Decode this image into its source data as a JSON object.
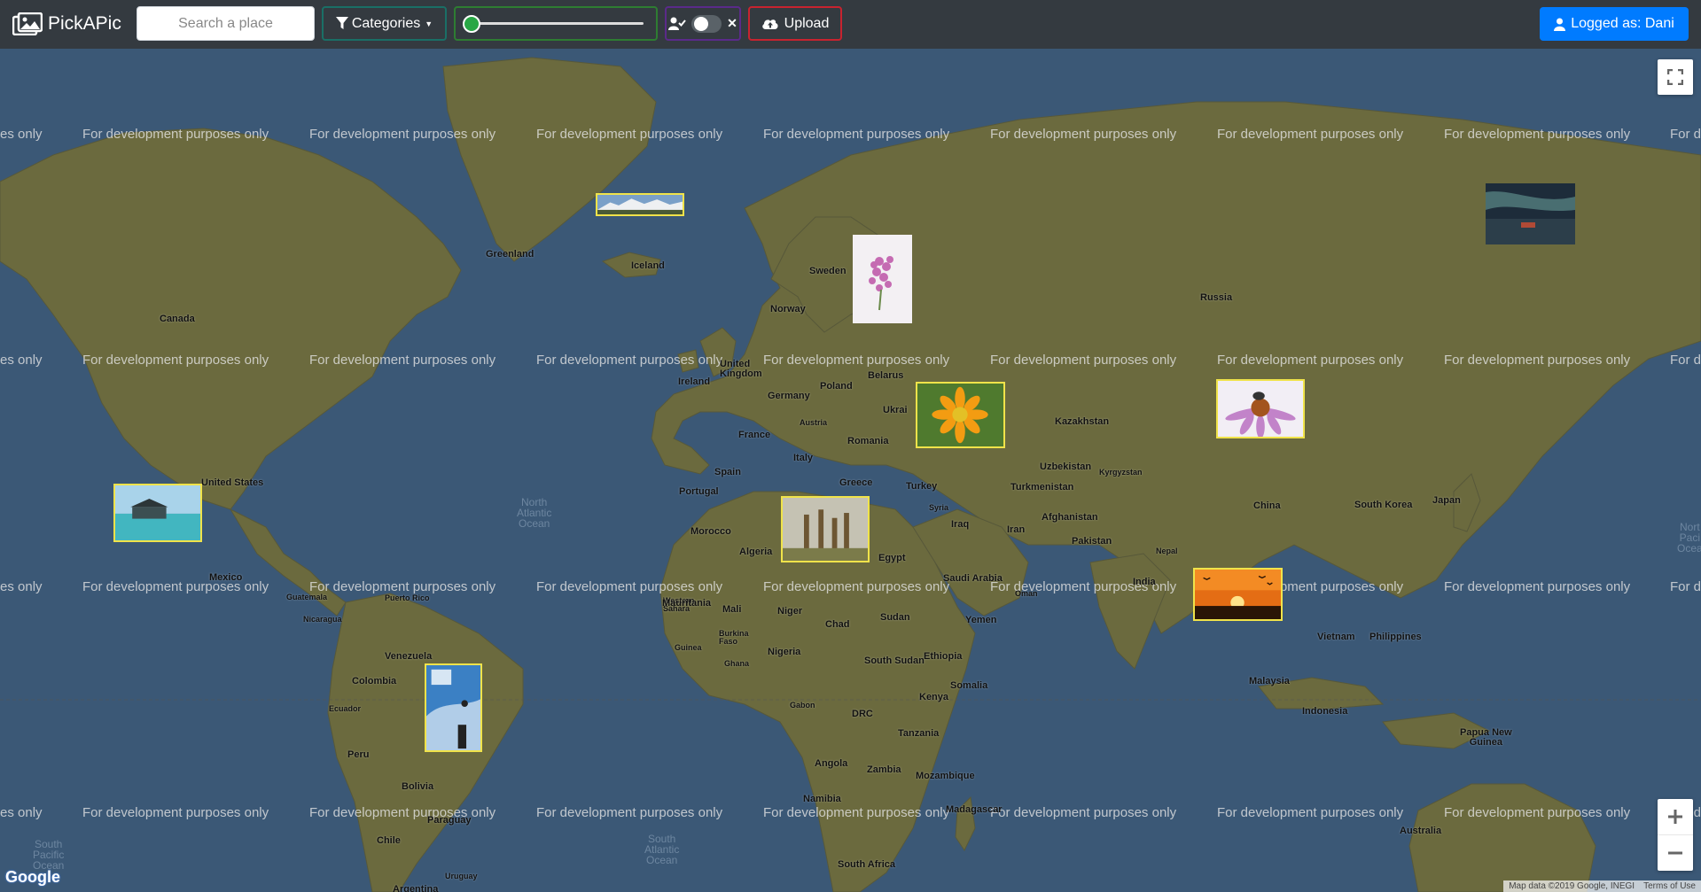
{
  "navbar": {
    "brand": "PickAPic",
    "search_placeholder": "Search a place",
    "categories_label": "Categories",
    "upload_label": "Upload",
    "user_label": "Logged as: Dani",
    "toggle_icon_user": "user-check-icon",
    "toggle_icon_close": "close-icon"
  },
  "map": {
    "watermark": "For development purposes only",
    "watermark_left": "es only",
    "watermark_right": "For d",
    "attribution_data": "Map data ©2019 Google, INEGI",
    "attribution_terms": "Terms of Use",
    "google_logo": "Google",
    "places": {
      "greenland": "Greenland",
      "iceland": "Iceland",
      "canada": "Canada",
      "united_states": "United States",
      "mexico": "Mexico",
      "sweden": "Sweden",
      "norway": "Norway",
      "russia": "Russia",
      "united_kingdom": "United\nKingdom",
      "ireland": "Ireland",
      "belarus": "Belarus",
      "poland": "Poland",
      "germany": "Germany",
      "france": "France",
      "ukraine": "Ukrai",
      "austria": "Austria",
      "romania": "Romania",
      "kazakhstan": "Kazakhstan",
      "spain": "Spain",
      "italy": "Italy",
      "portugal": "Portugal",
      "greece": "Greece",
      "turkey": "Turkey",
      "uzbekistan": "Uzbekistan",
      "turkmenistan": "Turkmenistan",
      "china": "China",
      "south_korea": "South Korea",
      "japan": "Japan",
      "morocco": "Morocco",
      "algeria": "Algeria",
      "egypt": "Egypt",
      "iraq": "Iraq",
      "iran": "Iran",
      "afghanistan": "Afghanistan",
      "pakistan": "Pakistan",
      "saudi_arabia": "Saudi Arabia",
      "india": "India",
      "mauritania": "Mauritania",
      "mali": "Mali",
      "niger": "Niger",
      "chad": "Chad",
      "sudan": "Sudan",
      "yemen": "Yemen",
      "nigeria": "Nigeria",
      "ethiopia": "Ethiopia",
      "south_sudan": "South Sudan",
      "somalia": "Somalia",
      "kenya": "Kenya",
      "drc": "DRC",
      "tanzania": "Tanzania",
      "angola": "Angola",
      "zambia": "Zambia",
      "mozambique": "Mozambique",
      "namibia": "Namibia",
      "madagascar": "Madagascar",
      "south_africa": "South Africa",
      "venezuela": "Venezuela",
      "colombia": "Colombia",
      "peru": "Peru",
      "bolivia": "Bolivia",
      "chile": "Chile",
      "paraguay": "Paraguay",
      "argentina": "Argentina",
      "uruguay": "Uruguay",
      "ecuador": "Ecuador",
      "vietnam": "Vietnam",
      "philippines": "Philippines",
      "malaysia": "Malaysia",
      "indonesia": "Indonesia",
      "papua_new_guinea": "Papua New\nGuinea",
      "australia": "Australia",
      "guatemala": "Guatemala",
      "puerto_rico": "Puerto Rico",
      "nicaragua": "Nicaragua",
      "gabon": "Gabon",
      "western_sahara": "Western\nSahara",
      "burkina_faso": "Burkina\nFaso",
      "guinea": "Guinea",
      "ghana": "Ghana",
      "syria": "Syria",
      "oman": "Oman",
      "kyrgyzstan": "Kyrgyzstan",
      "nepal": "Nepal"
    },
    "oceans": {
      "north_atlantic": "North\nAtlantic\nOcean",
      "south_atlantic": "South\nAtlantic\nOcean",
      "south_pacific": "South\nPacific\nOcean",
      "north_pacific": "Nort\nPaci\nOcea"
    }
  },
  "colors": {
    "navbar_bg": "#343a40",
    "ocean": "#3b5876",
    "land": "#6d6a3c",
    "marker_border": "#f0e34a",
    "user_button": "#007bff",
    "categories_border": "#1a6f66",
    "slider_border": "#2e7d32",
    "toggle_border": "#5b2a8a",
    "upload_border": "#c8232f"
  }
}
